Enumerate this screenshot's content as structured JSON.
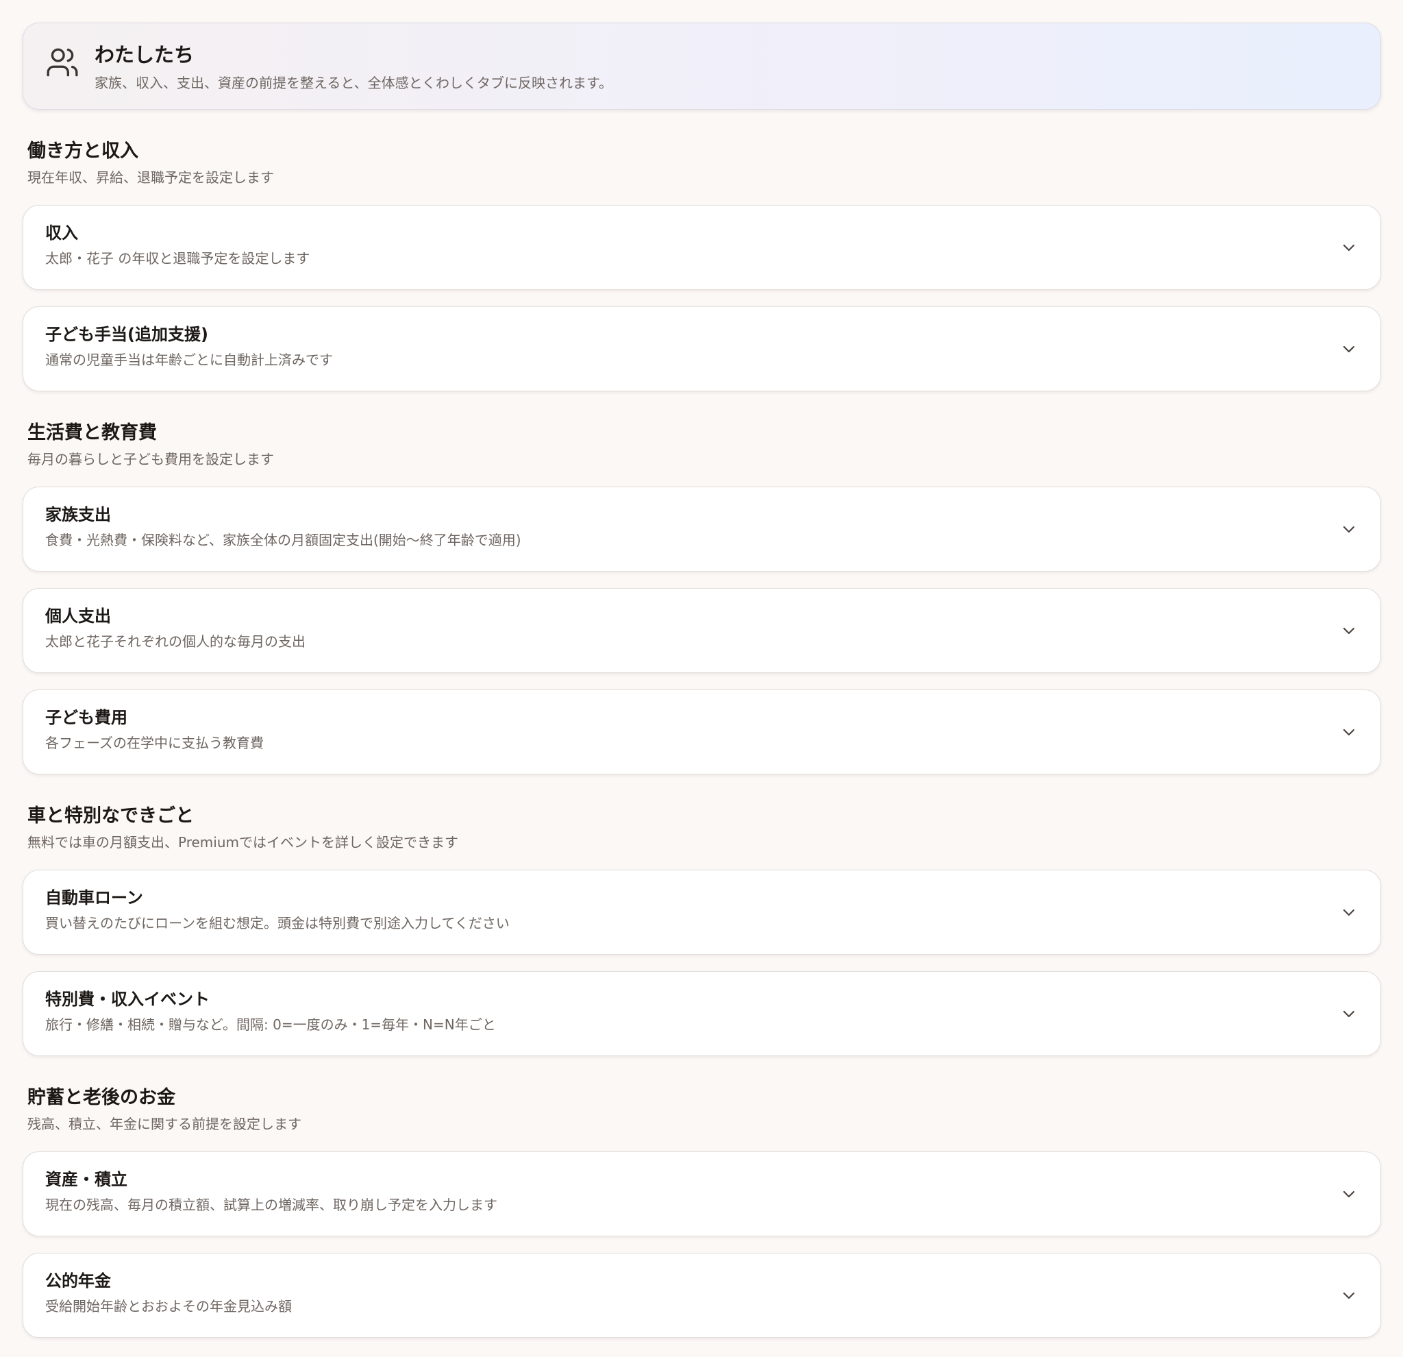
{
  "header": {
    "title": "わたしたち",
    "subtitle": "家族、収入、支出、資産の前提を整えると、全体感とくわしくタブに反映されます。",
    "icon": "users-icon"
  },
  "sections": [
    {
      "title": "働き方と収入",
      "subtitle": "現在年収、昇給、退職予定を設定します",
      "cards": [
        {
          "title": "収入",
          "subtitle": "太郎・花子 の年収と退職予定を設定します"
        },
        {
          "title": "子ども手当(追加支援)",
          "subtitle": "通常の児童手当は年齢ごとに自動計上済みです"
        }
      ]
    },
    {
      "title": "生活費と教育費",
      "subtitle": "毎月の暮らしと子ども費用を設定します",
      "cards": [
        {
          "title": "家族支出",
          "subtitle": "食費・光熱費・保険料など、家族全体の月額固定支出(開始〜終了年齢で適用)"
        },
        {
          "title": "個人支出",
          "subtitle": "太郎と花子それぞれの個人的な毎月の支出"
        },
        {
          "title": "子ども費用",
          "subtitle": "各フェーズの在学中に支払う教育費"
        }
      ]
    },
    {
      "title": "車と特別なできごと",
      "subtitle": "無料では車の月額支出、Premiumではイベントを詳しく設定できます",
      "cards": [
        {
          "title": "自動車ローン",
          "subtitle": "買い替えのたびにローンを組む想定。頭金は特別費で別途入力してください"
        },
        {
          "title": "特別費・収入イベント",
          "subtitle": "旅行・修繕・相続・贈与など。間隔: 0=一度のみ・1=毎年・N=N年ごと"
        }
      ]
    },
    {
      "title": "貯蓄と老後のお金",
      "subtitle": "残高、積立、年金に関する前提を設定します",
      "cards": [
        {
          "title": "資産・積立",
          "subtitle": "現在の残高、毎月の積立額、試算上の増減率、取り崩し予定を入力します"
        },
        {
          "title": "公的年金",
          "subtitle": "受給開始年齢とおおよその年金見込み額"
        }
      ]
    }
  ],
  "chevron_icon": "chevron-down-icon"
}
